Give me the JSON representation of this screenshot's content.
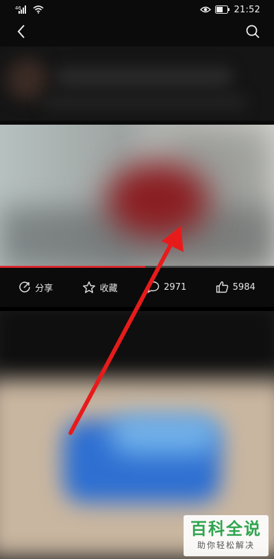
{
  "status_bar": {
    "signal_label": "⁶",
    "time": "21:52",
    "icons": [
      "signal-icon",
      "wifi-icon",
      "eye-icon",
      "battery-icon"
    ]
  },
  "nav": {
    "back_icon": "chevron-left-icon",
    "search_icon": "search-icon"
  },
  "video": {
    "progress_fraction": 0.53
  },
  "actions": {
    "share_label": "分享",
    "favorite_label": "收藏",
    "comment_count": "2971",
    "like_count": "5984",
    "icons": [
      "share-icon",
      "star-icon",
      "comment-icon",
      "thumbs-up-icon"
    ]
  },
  "watermark": {
    "title": "百科全说",
    "subtitle": "助你轻松解决"
  },
  "colors": {
    "accent": "#d8262b",
    "arrow": "#e81b1b",
    "watermark_green": "#2fa44f"
  }
}
